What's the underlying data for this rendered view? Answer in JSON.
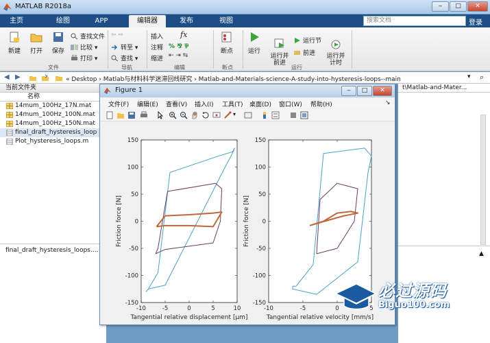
{
  "window": {
    "title": "MATLAB R2018a"
  },
  "tabs": [
    {
      "label": "主页"
    },
    {
      "label": "绘图"
    },
    {
      "label": "APP"
    },
    {
      "label": "编辑器"
    },
    {
      "label": "发布"
    },
    {
      "label": "视图"
    }
  ],
  "search": {
    "placeholder": "搜索文档"
  },
  "login": "登录",
  "ribbon": {
    "file": {
      "new": "新建",
      "open": "打开",
      "save": "保存",
      "find_files": "查找文件",
      "compare": "比较",
      "print": "打印",
      "group": "文件"
    },
    "nav": {
      "goto": "转至",
      "find": "查找",
      "group": "导航"
    },
    "edit": {
      "insert": "插入",
      "comment": "注释",
      "indent": "缩进",
      "fx": "fx",
      "group": "编辑"
    },
    "breakpoints": {
      "label": "断点",
      "group": "断点"
    },
    "run": {
      "run": "运行",
      "run_advance": "运行并\n前进",
      "run_section": "运行节",
      "advance": "前进",
      "run_time": "运行并\n计时",
      "group": "运行"
    }
  },
  "path": {
    "text": "« Desktop › Matlab与材料科学迷滞回线研究 › Matlab-and-Materials-science-A-study-into-hysteresis-loops--main"
  },
  "current_folder": {
    "header": "当前文件夹",
    "column": "名称",
    "files": [
      {
        "name": "14mum_100Hz_17N.mat",
        "type": "mat"
      },
      {
        "name": "14mum_100Hz_100N.mat",
        "type": "mat"
      },
      {
        "name": "14mum_100Hz_150N.mat",
        "type": "mat"
      },
      {
        "name": "final_draft_hysteresis_loop",
        "type": "m"
      },
      {
        "name": "Plot_hysteresis_loops.m",
        "type": "m"
      }
    ],
    "detail": "final_draft_hysteresis_loops...."
  },
  "right_panel": {
    "path": "t\\Matlab-and-Mater..."
  },
  "figure": {
    "title": "Figure 1",
    "menu": [
      "文件(F)",
      "编辑(E)",
      "查看(V)",
      "插入(I)",
      "工具(T)",
      "桌面(D)",
      "窗口(W)",
      "帮助(H)"
    ]
  },
  "chart_data": [
    {
      "type": "line",
      "xlabel": "Tangential relative displacement [μm]",
      "ylabel": "Friction force [N]",
      "xlim": [
        -10,
        10
      ],
      "ylim": [
        -150,
        150
      ],
      "xticks": [
        -10,
        -5,
        0,
        5,
        10
      ],
      "yticks": [
        -150,
        -100,
        -50,
        0,
        50,
        100,
        150
      ],
      "series": [
        {
          "color": "#4a9fc8",
          "x": [
            -8.5,
            -6.5,
            -4,
            6,
            9,
            9.5,
            9,
            7.5,
            -5,
            -8.5,
            -9,
            -8.5
          ],
          "y": [
            -125,
            -95,
            90,
            120,
            128,
            135,
            125,
            100,
            -118,
            -125,
            -130,
            -125
          ]
        },
        {
          "color": "#6b3a63",
          "x": [
            -7,
            -6.5,
            -4.5,
            5.5,
            6.8,
            6.5,
            5,
            -5,
            -7
          ],
          "y": [
            -60,
            -50,
            55,
            70,
            60,
            0,
            -40,
            -52,
            -60
          ]
        },
        {
          "color": "#c0673a",
          "x": [
            -6.8,
            -5,
            0,
            5,
            6.8,
            5,
            0,
            -5,
            -6.8
          ],
          "y": [
            -10,
            10,
            12,
            15,
            17,
            -10,
            -8,
            -8,
            -10
          ]
        }
      ]
    },
    {
      "type": "line",
      "xlabel": "Tangential relative velocity [mm/s]",
      "ylabel": "Friction force [N]",
      "xlim": [
        -10,
        5
      ],
      "ylim": [
        -150,
        150
      ],
      "xticks": [
        -10,
        -5,
        0,
        5
      ],
      "yticks": [
        -150,
        -100,
        -50,
        0,
        50,
        100,
        150
      ],
      "series": [
        {
          "color": "#4a9fc8",
          "x": [
            -6,
            -3.5,
            -2,
            4,
            5,
            4.5,
            3,
            -3,
            -6.5,
            -6.5,
            -6
          ],
          "y": [
            -120,
            -80,
            125,
            135,
            120,
            90,
            -75,
            -135,
            -125,
            -120,
            -120
          ]
        },
        {
          "color": "#6b3a63",
          "x": [
            -3,
            -2.5,
            0,
            3,
            2.5,
            0,
            -3
          ],
          "y": [
            -60,
            40,
            70,
            60,
            0,
            -50,
            -60
          ]
        },
        {
          "color": "#c0673a",
          "x": [
            -4,
            -2,
            0,
            2,
            3,
            1,
            -1,
            -4
          ],
          "y": [
            -8,
            0,
            15,
            18,
            15,
            10,
            3,
            -8
          ]
        }
      ]
    }
  ],
  "watermark": {
    "main": "必过源码",
    "sub": "Biguo100.com"
  }
}
